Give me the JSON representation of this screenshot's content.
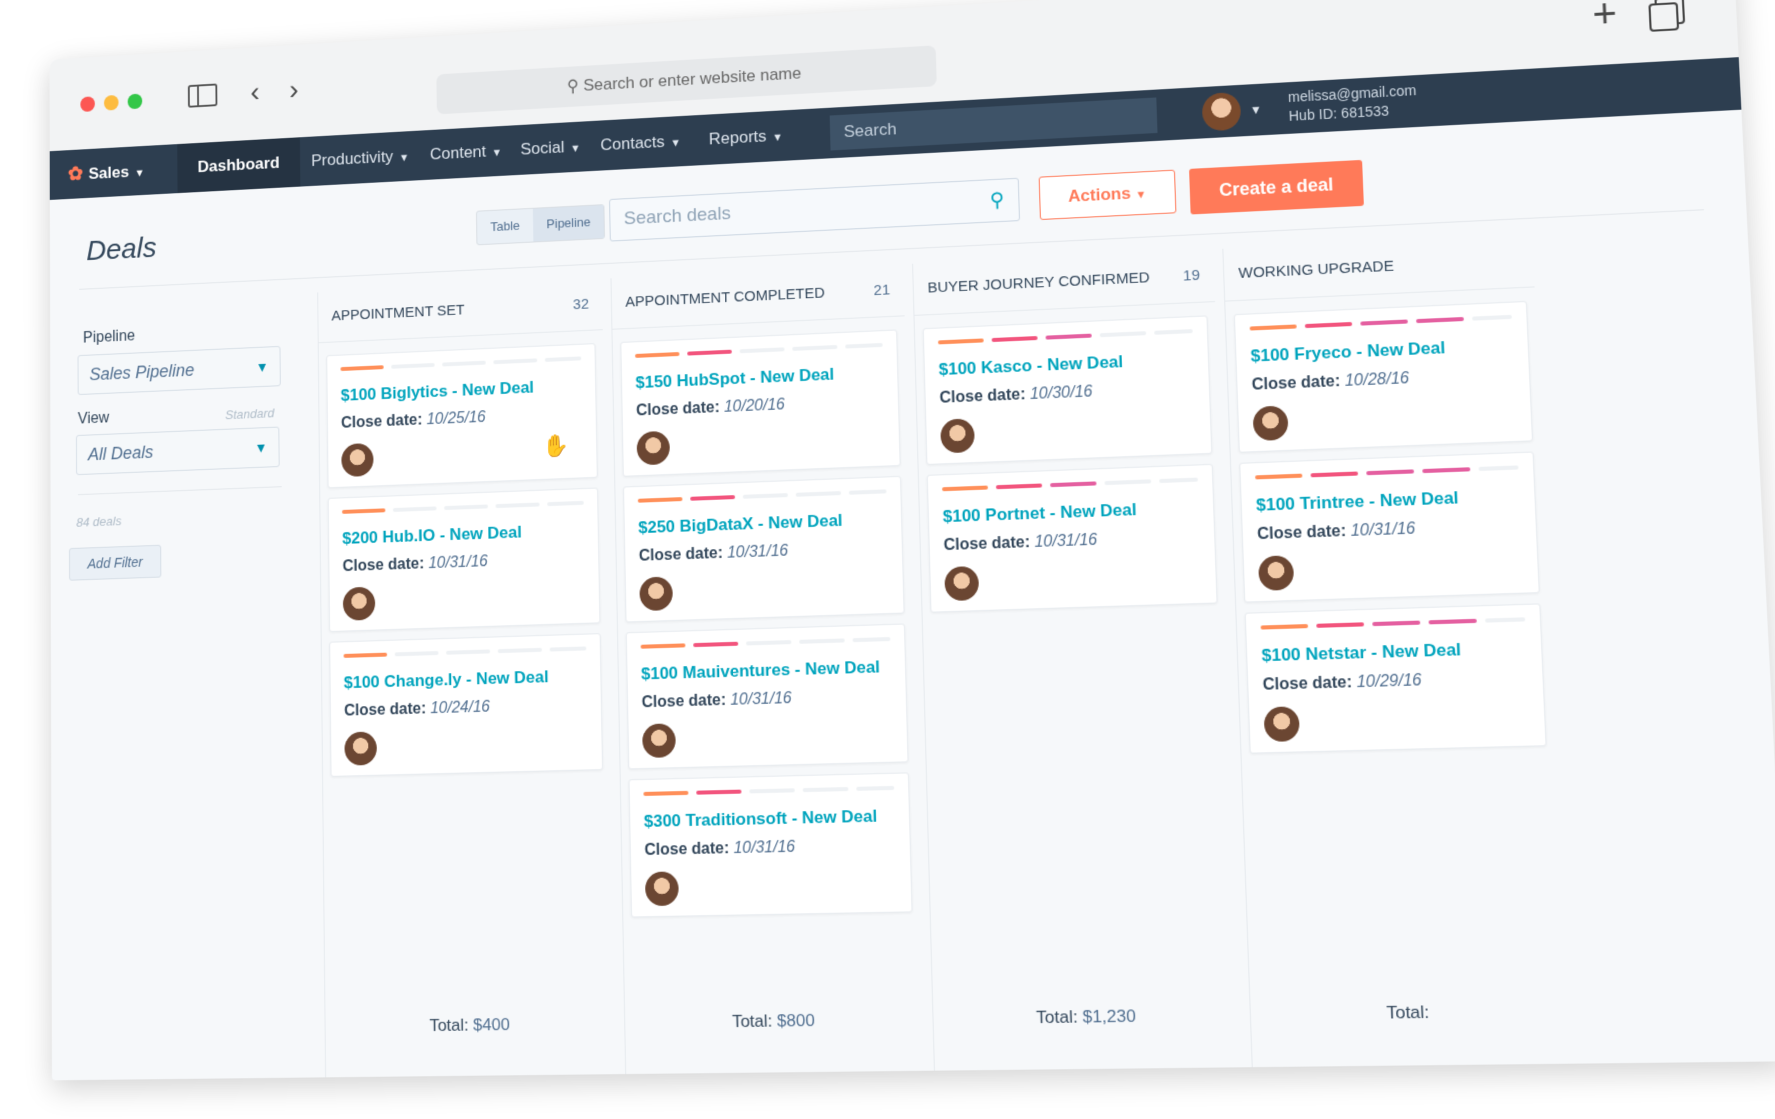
{
  "browser": {
    "url_placeholder": "Search or enter website name",
    "search_icon": "search-icon",
    "new_tab_icon": "plus-icon",
    "tabs_icon": "tabs-icon"
  },
  "nav": {
    "brand": "Sales",
    "items": [
      "Dashboard",
      "Productivity",
      "Content",
      "Social",
      "Contacts",
      "Reports"
    ],
    "search_placeholder": "Search",
    "account_email": "melissa@gmail.com",
    "hub_id": "Hub ID: 681533",
    "colors": {
      "bar": "#2d3e50",
      "accent": "#ff7a59"
    }
  },
  "page": {
    "title": "Deals",
    "view_toggle": [
      "Table",
      "Pipeline"
    ],
    "search_placeholder": "Search deals",
    "actions_label": "Actions",
    "create_label": "Create a deal"
  },
  "sidebar": {
    "pipeline_label": "Pipeline",
    "pipeline_value": "Sales Pipeline",
    "view_label": "View",
    "view_hint": "Standard",
    "view_value": "All Deals",
    "deal_count": "84 deals",
    "add_filter": "Add Filter"
  },
  "columns": [
    {
      "name": "APPOINTMENT SET",
      "count": "32",
      "total_label": "Total:",
      "total": "$400",
      "cards": [
        {
          "title": "$100 Biglytics - New Deal",
          "date_label": "Close date:",
          "date": "10/25/16",
          "bars": 1
        },
        {
          "title": "$200 Hub.IO - New Deal",
          "date_label": "Close date:",
          "date": "10/31/16",
          "bars": 1
        },
        {
          "title": "$100 Change.ly - New Deal",
          "date_label": "Close date:",
          "date": "10/24/16",
          "bars": 1
        }
      ]
    },
    {
      "name": "APPOINTMENT COMPLETED",
      "count": "21",
      "total_label": "Total:",
      "total": "$800",
      "cards": [
        {
          "title": "$150 HubSpot - New Deal",
          "date_label": "Close date:",
          "date": "10/20/16",
          "bars": 2
        },
        {
          "title": "$250 BigDataX - New Deal",
          "date_label": "Close date:",
          "date": "10/31/16",
          "bars": 2
        },
        {
          "title": "$100 Mauiventures - New Deal",
          "date_label": "Close date:",
          "date": "10/31/16",
          "bars": 2
        },
        {
          "title": "$300 Traditionsoft - New Deal",
          "date_label": "Close date:",
          "date": "10/31/16",
          "bars": 2
        }
      ]
    },
    {
      "name": "BUYER JOURNEY CONFIRMED",
      "count": "19",
      "total_label": "Total:",
      "total": "$1,230",
      "cards": [
        {
          "title": "$100 Kasco - New Deal",
          "date_label": "Close date:",
          "date": "10/30/16",
          "bars": 3
        },
        {
          "title": "$100 Portnet - New Deal",
          "date_label": "Close date:",
          "date": "10/31/16",
          "bars": 3
        }
      ]
    },
    {
      "name": "WORKING UPGRADE",
      "count": "",
      "total_label": "Total:",
      "total": "",
      "cards": [
        {
          "title": "$100 Fryeco - New Deal",
          "date_label": "Close date:",
          "date": "10/28/16",
          "bars": 4
        },
        {
          "title": "$100 Trintree - New Deal",
          "date_label": "Close date:",
          "date": "10/31/16",
          "bars": 4
        },
        {
          "title": "$100 Netstar - New Deal",
          "date_label": "Close date:",
          "date": "10/29/16",
          "bars": 4
        }
      ]
    }
  ]
}
